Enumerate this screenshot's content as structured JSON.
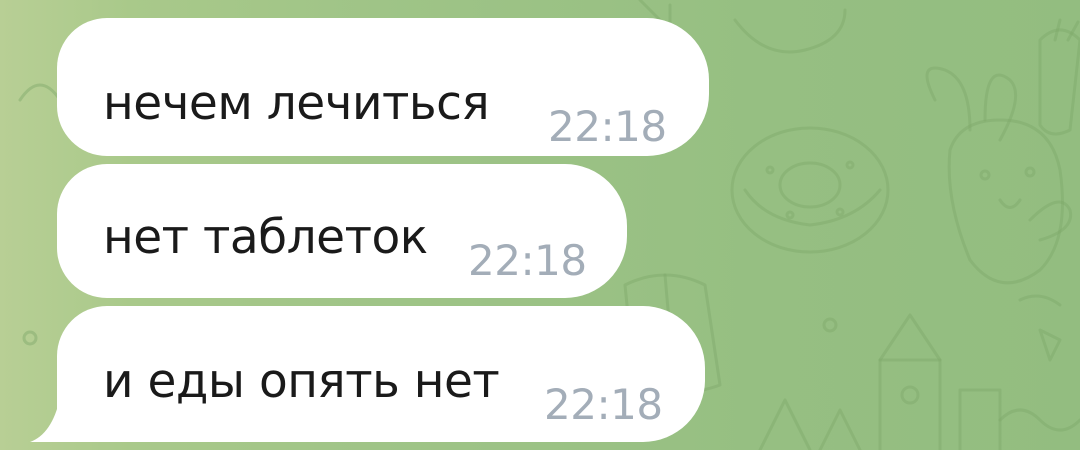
{
  "chat": {
    "messages": [
      {
        "text": "нечем лечиться",
        "time": "22:18"
      },
      {
        "text": "нет таблеток",
        "time": "22:18"
      },
      {
        "text": "и еды опять нет",
        "time": "22:18"
      }
    ]
  },
  "colors": {
    "background": "#9fc487",
    "bubble": "#ffffff",
    "text": "#1a1a1a",
    "time": "#a3adb8"
  }
}
